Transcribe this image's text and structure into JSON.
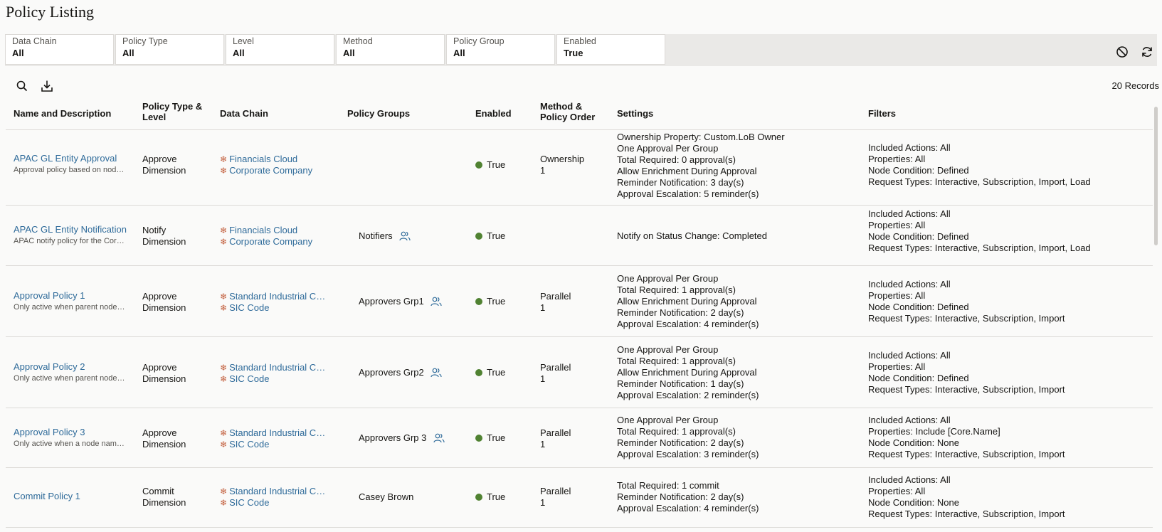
{
  "page": {
    "title": "Policy Listing"
  },
  "filters": [
    {
      "label": "Data Chain",
      "value": "All"
    },
    {
      "label": "Policy Type",
      "value": "All"
    },
    {
      "label": "Level",
      "value": "All"
    },
    {
      "label": "Method",
      "value": "All"
    },
    {
      "label": "Policy Group",
      "value": "All"
    },
    {
      "label": "Enabled",
      "value": "True"
    }
  ],
  "filter_bar_icons": [
    "clear-filters-icon",
    "refresh-icon"
  ],
  "toolbar": {
    "icons": [
      "search-icon",
      "download-icon"
    ],
    "record_count": "20 Records"
  },
  "columns": [
    "Name and Description",
    "Policy Type & Level",
    "Data Chain",
    "Policy Groups",
    "Enabled",
    "Method & Policy Order",
    "Settings",
    "Filters"
  ],
  "rows": [
    {
      "name": "APAC GL Entity Approval",
      "description": "Approval policy based on node ownership",
      "type": "Approve",
      "level": "Dimension",
      "data_chain": [
        "Financials Cloud",
        "Corporate Company"
      ],
      "policy_group": "",
      "enabled": "True",
      "method": "Ownership",
      "order": "1",
      "settings": [
        "Ownership Property: Custom.LoB Owner",
        "One Approval Per Group",
        "Total Required: 0 approval(s)",
        "Allow Enrichment During Approval",
        "Reminder Notification: 3 day(s)",
        "Approval Escalation: 5 reminder(s)"
      ],
      "filters": [
        "Included Actions: All",
        "Properties: All",
        "Node Condition: Defined",
        "Request Types: Interactive, Subscription, Import, Load"
      ]
    },
    {
      "name": "APAC GL Entity Notification",
      "description": "APAC notify policy for the Corporate Company",
      "type": "Notify",
      "level": "Dimension",
      "data_chain": [
        "Financials Cloud",
        "Corporate Company"
      ],
      "policy_group": "Notifiers",
      "enabled": "True",
      "method": "",
      "order": "",
      "settings": [
        "Notify on Status Change: Completed"
      ],
      "filters": [
        "Included Actions: All",
        "Properties: All",
        "Node Condition: Defined",
        "Request Types: Interactive, Subscription, Import, Load"
      ]
    },
    {
      "name": "Approval Policy 1",
      "description": "Only active when parent node is defined",
      "type": "Approve",
      "level": "Dimension",
      "data_chain": [
        "Standard Industrial Classification",
        "SIC Code"
      ],
      "policy_group": "Approvers Grp1",
      "enabled": "True",
      "method": "Parallel",
      "order": "1",
      "settings": [
        "One Approval Per Group",
        "Total Required: 1 approval(s)",
        "Allow Enrichment During Approval",
        "Reminder Notification: 2 day(s)",
        "Approval Escalation: 4 reminder(s)"
      ],
      "filters": [
        "Included Actions: All",
        "Properties: All",
        "Node Condition: Defined",
        "Request Types: Interactive, Subscription, Import"
      ]
    },
    {
      "name": "Approval Policy 2",
      "description": "Only active when parent node is defined",
      "type": "Approve",
      "level": "Dimension",
      "data_chain": [
        "Standard Industrial Classification",
        "SIC Code"
      ],
      "policy_group": "Approvers Grp2",
      "enabled": "True",
      "method": "Parallel",
      "order": "1",
      "settings": [
        "One Approval Per Group",
        "Total Required: 1 approval(s)",
        "Allow Enrichment During Approval",
        "Reminder Notification: 1 day(s)",
        "Approval Escalation: 2 reminder(s)"
      ],
      "filters": [
        "Included Actions: All",
        "Properties: All",
        "Node Condition: Defined",
        "Request Types: Interactive, Subscription, Import"
      ]
    },
    {
      "name": "Approval Policy 3",
      "description": "Only active when a node name matches",
      "type": "Approve",
      "level": "Dimension",
      "data_chain": [
        "Standard Industrial Classification",
        "SIC Code"
      ],
      "policy_group": "Approvers Grp 3",
      "enabled": "True",
      "method": "Parallel",
      "order": "1",
      "settings": [
        "One Approval Per Group",
        "Total Required: 1 approval(s)",
        "Reminder Notification: 2 day(s)",
        "Approval Escalation: 3 reminder(s)"
      ],
      "filters": [
        "Included Actions: All",
        "Properties: Include [Core.Name]",
        "Node Condition: None",
        "Request Types: Interactive, Subscription, Import"
      ]
    },
    {
      "name": "Commit Policy 1",
      "description": "",
      "type": "Commit",
      "level": "Dimension",
      "data_chain": [
        "Standard Industrial Classification",
        "SIC Code"
      ],
      "policy_group": "Casey Brown",
      "enabled": "True",
      "method": "Parallel",
      "order": "1",
      "settings": [
        "Total Required: 1 commit",
        "Reminder Notification: 2 day(s)",
        "Approval Escalation: 4 reminder(s)"
      ],
      "filters": [
        "Included Actions: All",
        "Properties: All",
        "Node Condition: None",
        "Request Types: Interactive, Subscription, Import"
      ]
    }
  ]
}
